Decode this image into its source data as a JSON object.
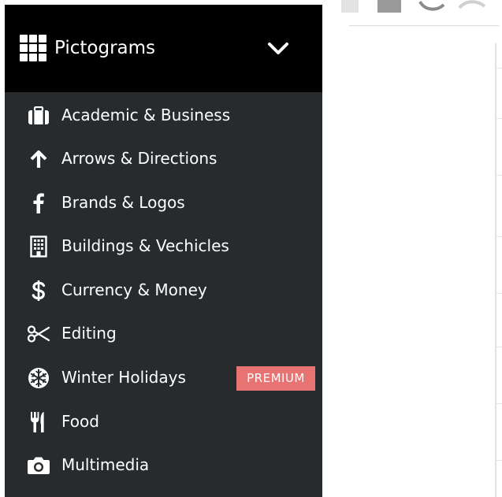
{
  "header": {
    "title": "Pictograms",
    "icon": "grid-icon",
    "toggle_icon": "chevron-down-icon"
  },
  "categories": [
    {
      "label": "Academic & Business",
      "icon": "briefcase-icon"
    },
    {
      "label": "Arrows & Directions",
      "icon": "arrow-up-icon"
    },
    {
      "label": "Brands & Logos",
      "icon": "facebook-icon"
    },
    {
      "label": "Buildings & Vechicles",
      "icon": "building-icon"
    },
    {
      "label": "Currency & Money",
      "icon": "dollar-icon"
    },
    {
      "label": "Editing",
      "icon": "scissors-icon"
    },
    {
      "label": "Winter Holidays",
      "icon": "snowflake-icon",
      "badge": "PREMIUM"
    },
    {
      "label": "Food",
      "icon": "fork-knife-icon"
    },
    {
      "label": "Multimedia",
      "icon": "camera-icon"
    }
  ],
  "colors": {
    "header_bg": "#000000",
    "sidebar_bg": "#272b2e",
    "badge_bg": "#e87373",
    "text": "#ffffff"
  }
}
